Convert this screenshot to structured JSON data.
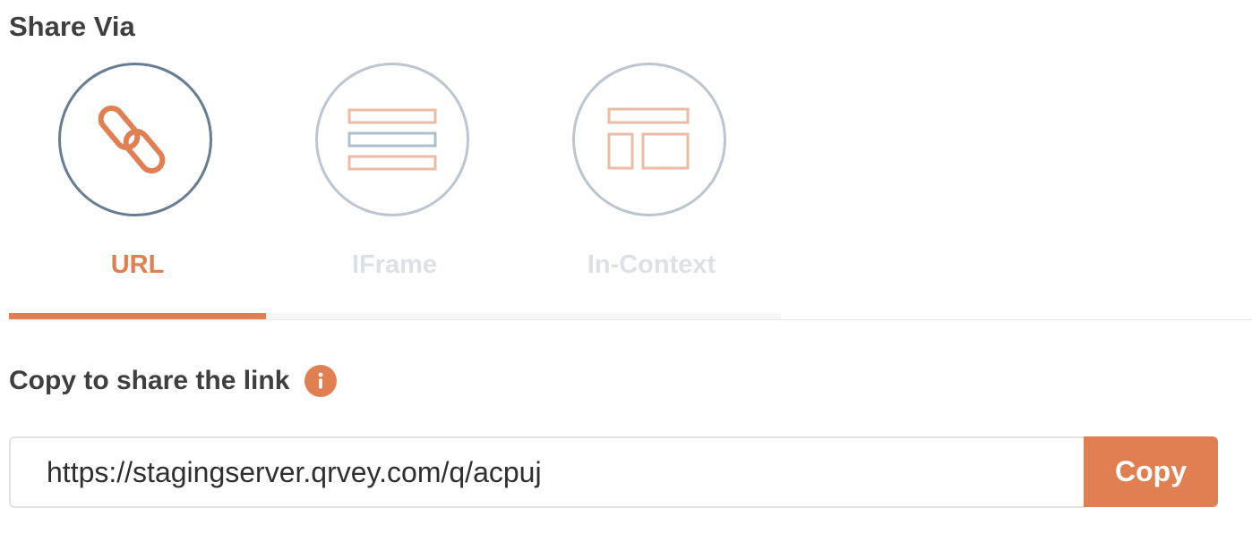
{
  "share": {
    "title": "Share Via",
    "options": [
      {
        "label": "URL",
        "icon": "link-icon",
        "active": true
      },
      {
        "label": "IFrame",
        "icon": "iframe-layout-icon",
        "active": false
      },
      {
        "label": "In-Context",
        "icon": "in-context-layout-icon",
        "active": false
      }
    ]
  },
  "link_section": {
    "heading": "Copy to share the link",
    "info_icon": "info-icon",
    "url_value": "https://stagingserver.qrvey.com/q/acpuj",
    "copy_label": "Copy"
  },
  "colors": {
    "accent": "#e07f51",
    "active_border": "#687d93",
    "inactive_border": "#bcc6d1",
    "inactive_label": "#dde1e6"
  }
}
